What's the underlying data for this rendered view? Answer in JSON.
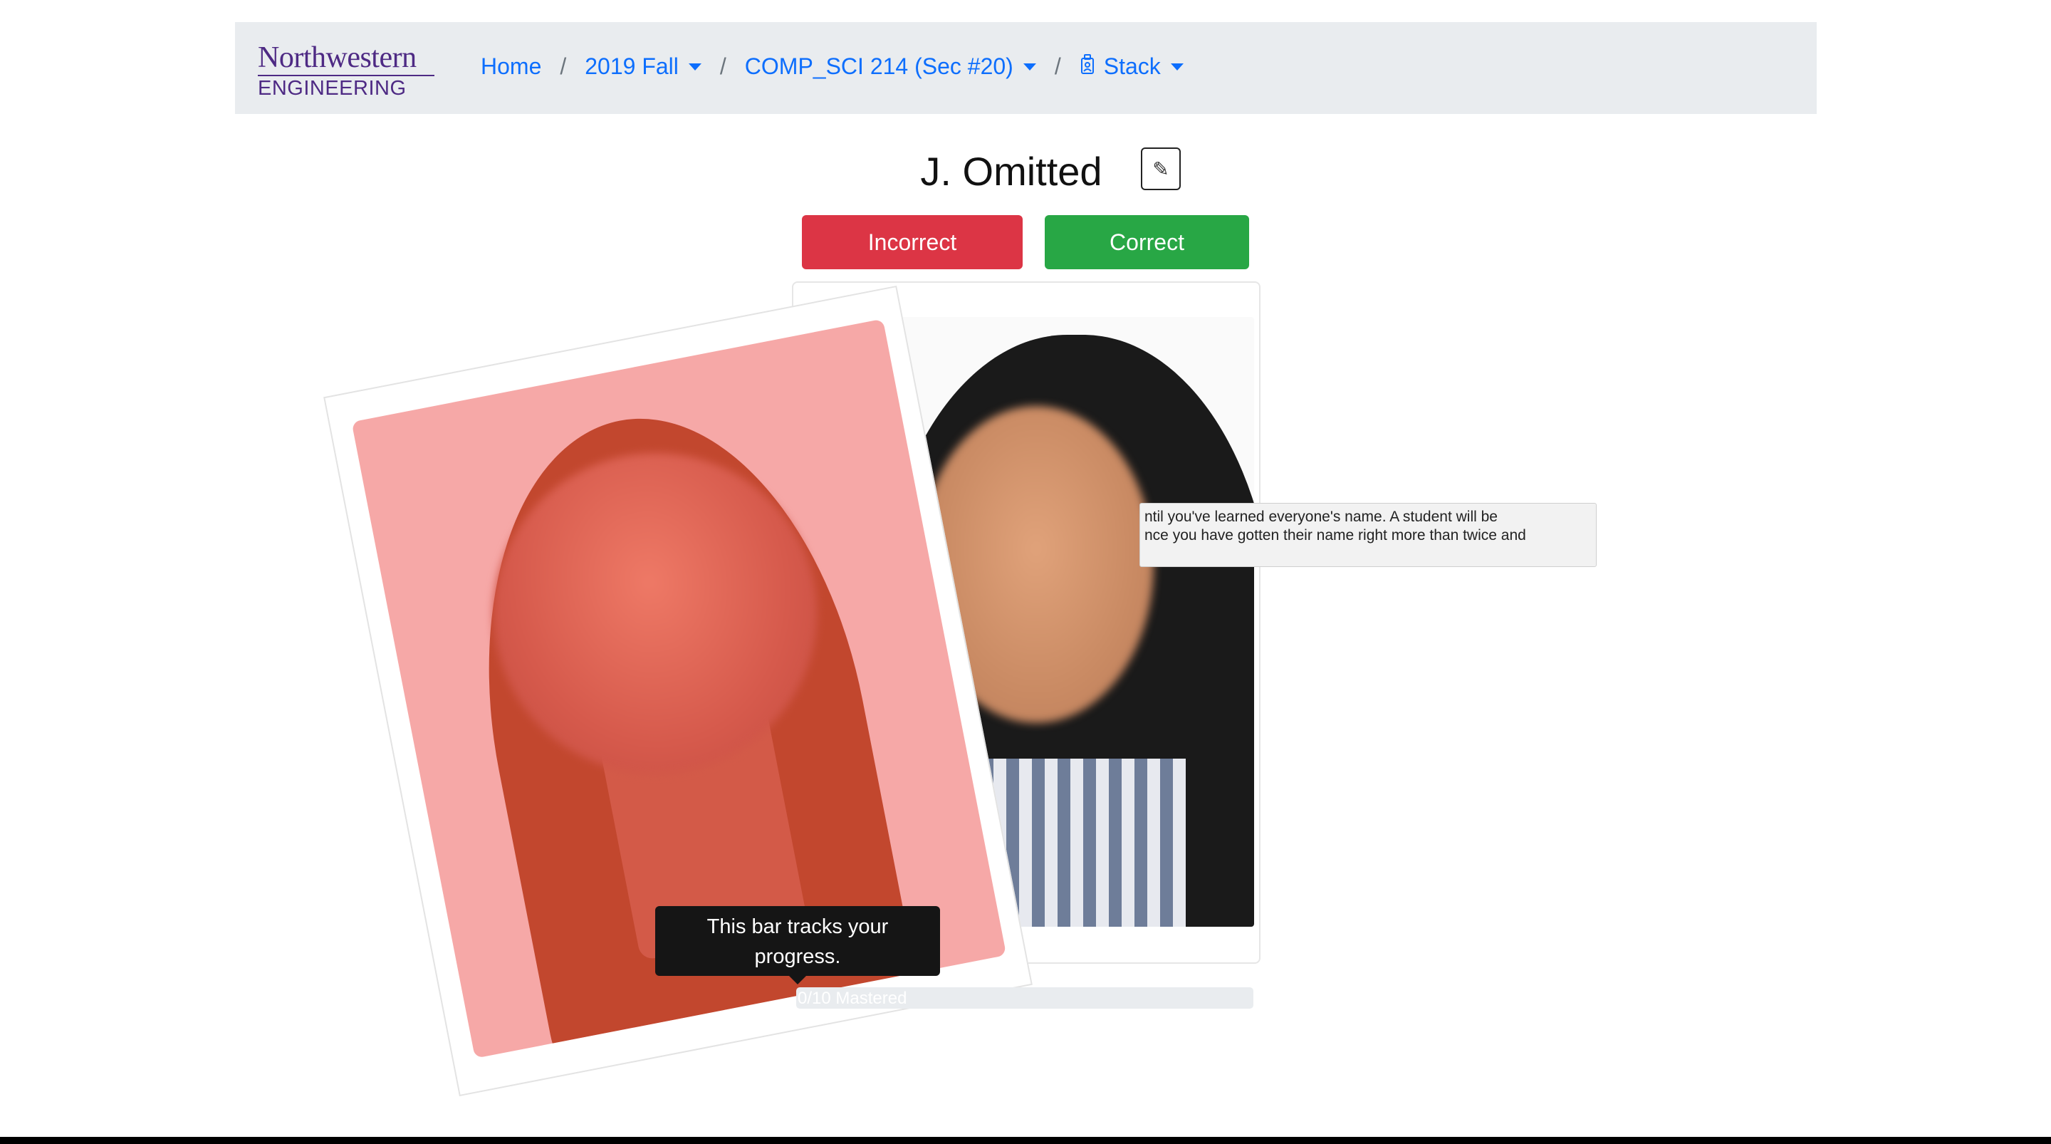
{
  "navbar": {
    "logo_top": "Northwestern",
    "logo_bottom": "ENGINEERING",
    "breadcrumbs": {
      "home": "Home",
      "term": "2019 Fall",
      "course": "COMP_SCI 214 (Sec #20)",
      "mode": "Stack"
    },
    "separator": "/"
  },
  "student": {
    "name": "J. Omitted",
    "edit_icon": "✎"
  },
  "actions": {
    "incorrect_label": "Incorrect",
    "correct_label": "Correct"
  },
  "popover": {
    "line1": "ntil you've learned everyone's name. A student will be",
    "line2": "nce you have gotten their name right more than twice and"
  },
  "tooltip": {
    "text_line1": "This bar tracks your",
    "text_line2": "progress."
  },
  "progress": {
    "label": "0/10 Mastered",
    "mastered": 0,
    "total": 10
  },
  "colors": {
    "navbar_bg": "#e9ecef",
    "link": "#0d6efd",
    "brand": "#4e2a84",
    "incorrect": "#dc3545",
    "correct": "#28a745"
  }
}
